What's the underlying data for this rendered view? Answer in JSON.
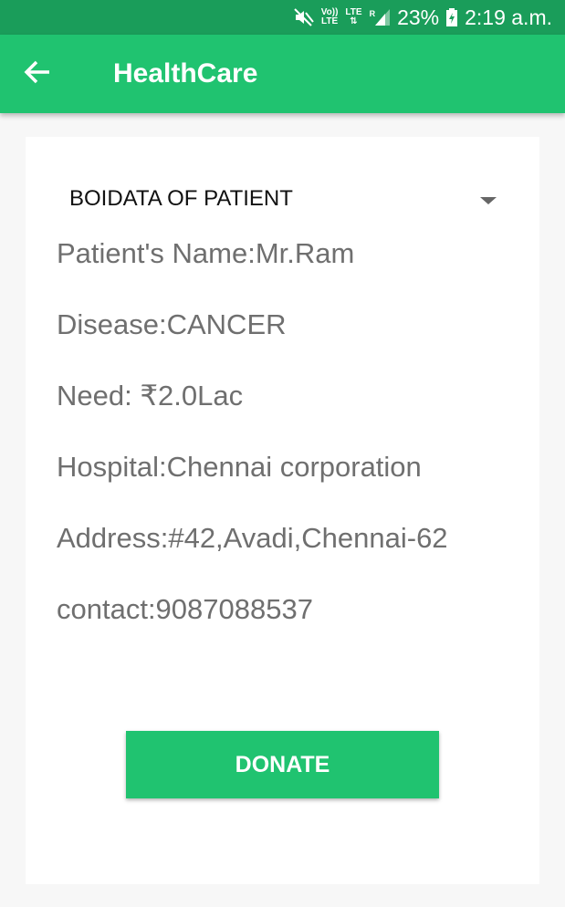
{
  "status_bar": {
    "vol_label": "Vo))",
    "lte_label_1": "LTE",
    "lte_label_2": "LTE",
    "roaming": "R",
    "battery_percent": "23%",
    "time": "2:19 a.m.",
    "icons": [
      "mute-icon",
      "signal-icon",
      "battery-charging-icon"
    ]
  },
  "app_bar": {
    "title": "HealthCare",
    "back_icon": "arrow-left-icon",
    "color": "#20c370"
  },
  "spinner": {
    "selected": "BOIDATA OF PATIENT"
  },
  "patient": {
    "name": "Patient's Name:Mr.Ram",
    "disease": "Disease:CANCER",
    "need": "Need: ₹2.0Lac",
    "hospital": "Hospital:Chennai corporation",
    "address": "Address:#42,Avadi,Chennai-62",
    "contact": "contact:9087088537"
  },
  "actions": {
    "donate_label": "DONATE"
  },
  "colors": {
    "status_bar": "#1a9d5a",
    "accent": "#20c370",
    "text_secondary": "#6f6f6f"
  }
}
